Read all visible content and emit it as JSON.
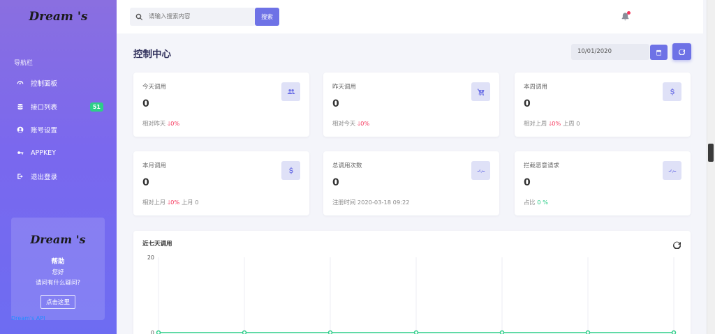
{
  "sidebar": {
    "logo": "Dream 's",
    "nav_heading": "导航栏",
    "items": [
      {
        "label": "控制面板",
        "icon": "gauge-icon"
      },
      {
        "label": "接口列表",
        "icon": "database-icon",
        "badge": "51"
      },
      {
        "label": "账号设置",
        "icon": "user-circle-icon"
      },
      {
        "label": "APPKEY",
        "icon": "key-icon"
      },
      {
        "label": "退出登录",
        "icon": "logout-icon"
      }
    ],
    "help": {
      "logo": "Dream 's",
      "title": "帮助",
      "line1": "您好",
      "line2": "请问有什么疑问?",
      "button": "点击这里"
    },
    "footer_link": "Dream's API"
  },
  "topbar": {
    "search_placeholder": "请输入搜索内容",
    "search_button": "搜索"
  },
  "header": {
    "title": "控制中心",
    "date": "10/01/2020"
  },
  "cards": [
    {
      "label": "今天调用",
      "value": "0",
      "sub_prefix": "相对昨天 ",
      "arrow": "🡓",
      "delta": "0%",
      "sub_suffix": "",
      "icon": "users-icon"
    },
    {
      "label": "昨天调用",
      "value": "0",
      "sub_prefix": "相对今天 ",
      "arrow": "🡓",
      "delta": "0%",
      "sub_suffix": "",
      "icon": "cart-icon"
    },
    {
      "label": "本周调用",
      "value": "0",
      "sub_prefix": "相对上周 ",
      "arrow": "🡓",
      "delta": "0%",
      "sub_suffix": " 上周 0",
      "icon": "dollar-icon"
    },
    {
      "label": "本月调用",
      "value": "0",
      "sub_prefix": "相对上月 ",
      "arrow": "🡓",
      "delta": "0%",
      "sub_suffix": " 上月 0",
      "icon": "dollar-icon"
    },
    {
      "label": "总调用次数",
      "value": "0",
      "sub_prefix": "注册时间 2020-03-18 09:22",
      "arrow": "",
      "delta": "",
      "sub_suffix": "",
      "icon": "pulse-icon"
    },
    {
      "label": "拦截恶意请求",
      "value": "0",
      "sub_prefix": "占比 ",
      "arrow": "",
      "delta": "",
      "up_delta": "0 %",
      "sub_suffix": "",
      "icon": "pulse-icon"
    }
  ],
  "chart_data": {
    "type": "line",
    "title": "近七天调用",
    "x": [
      "",
      "",
      "",
      "",
      "",
      "",
      ""
    ],
    "y_ticks": [
      "20",
      "0"
    ],
    "ylim": [
      0,
      20
    ],
    "series": [
      {
        "values": [
          0,
          0,
          0,
          0,
          0,
          0,
          0
        ]
      }
    ],
    "grid": true
  },
  "colors": {
    "accent": "#6e72e6",
    "danger": "#f5365c",
    "success": "#2dce89",
    "line": "#2dce89"
  }
}
